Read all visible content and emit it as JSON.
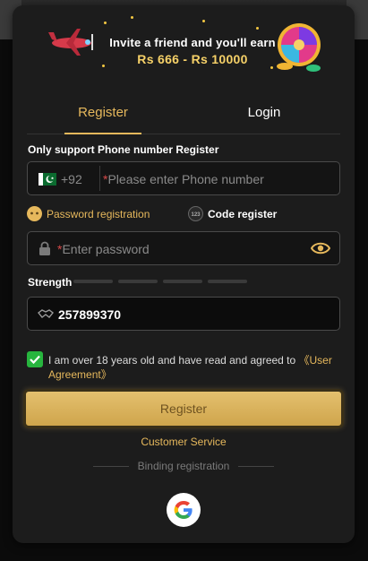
{
  "banner": {
    "line1": "Invite a friend and you'll earn",
    "line2": "Rs 666 - Rs 10000"
  },
  "tabs": [
    {
      "label": "Register",
      "active": true
    },
    {
      "label": "Login",
      "active": false
    }
  ],
  "form": {
    "support_text": "Only support Phone number Register",
    "phone": {
      "country_code": "+92",
      "placeholder": "Please enter Phone number",
      "required_mark": "*"
    },
    "options": {
      "password_registration": "Password registration",
      "code_register": "Code register",
      "code_icon_text": "123"
    },
    "password": {
      "placeholder": "Enter password",
      "required_mark": "*"
    },
    "strength_label": "Strength",
    "referral_value": "257899370",
    "agreement": {
      "text": "I am over 18 years old and have read and agreed to ",
      "link": "《User Agreement》",
      "checked": true
    },
    "register_button": "Register",
    "customer_service": "Customer Service",
    "binding_label": "Binding registration"
  },
  "colors": {
    "accent": "#e6b85c",
    "background": "#1c1c1c",
    "check": "#27b53e"
  }
}
